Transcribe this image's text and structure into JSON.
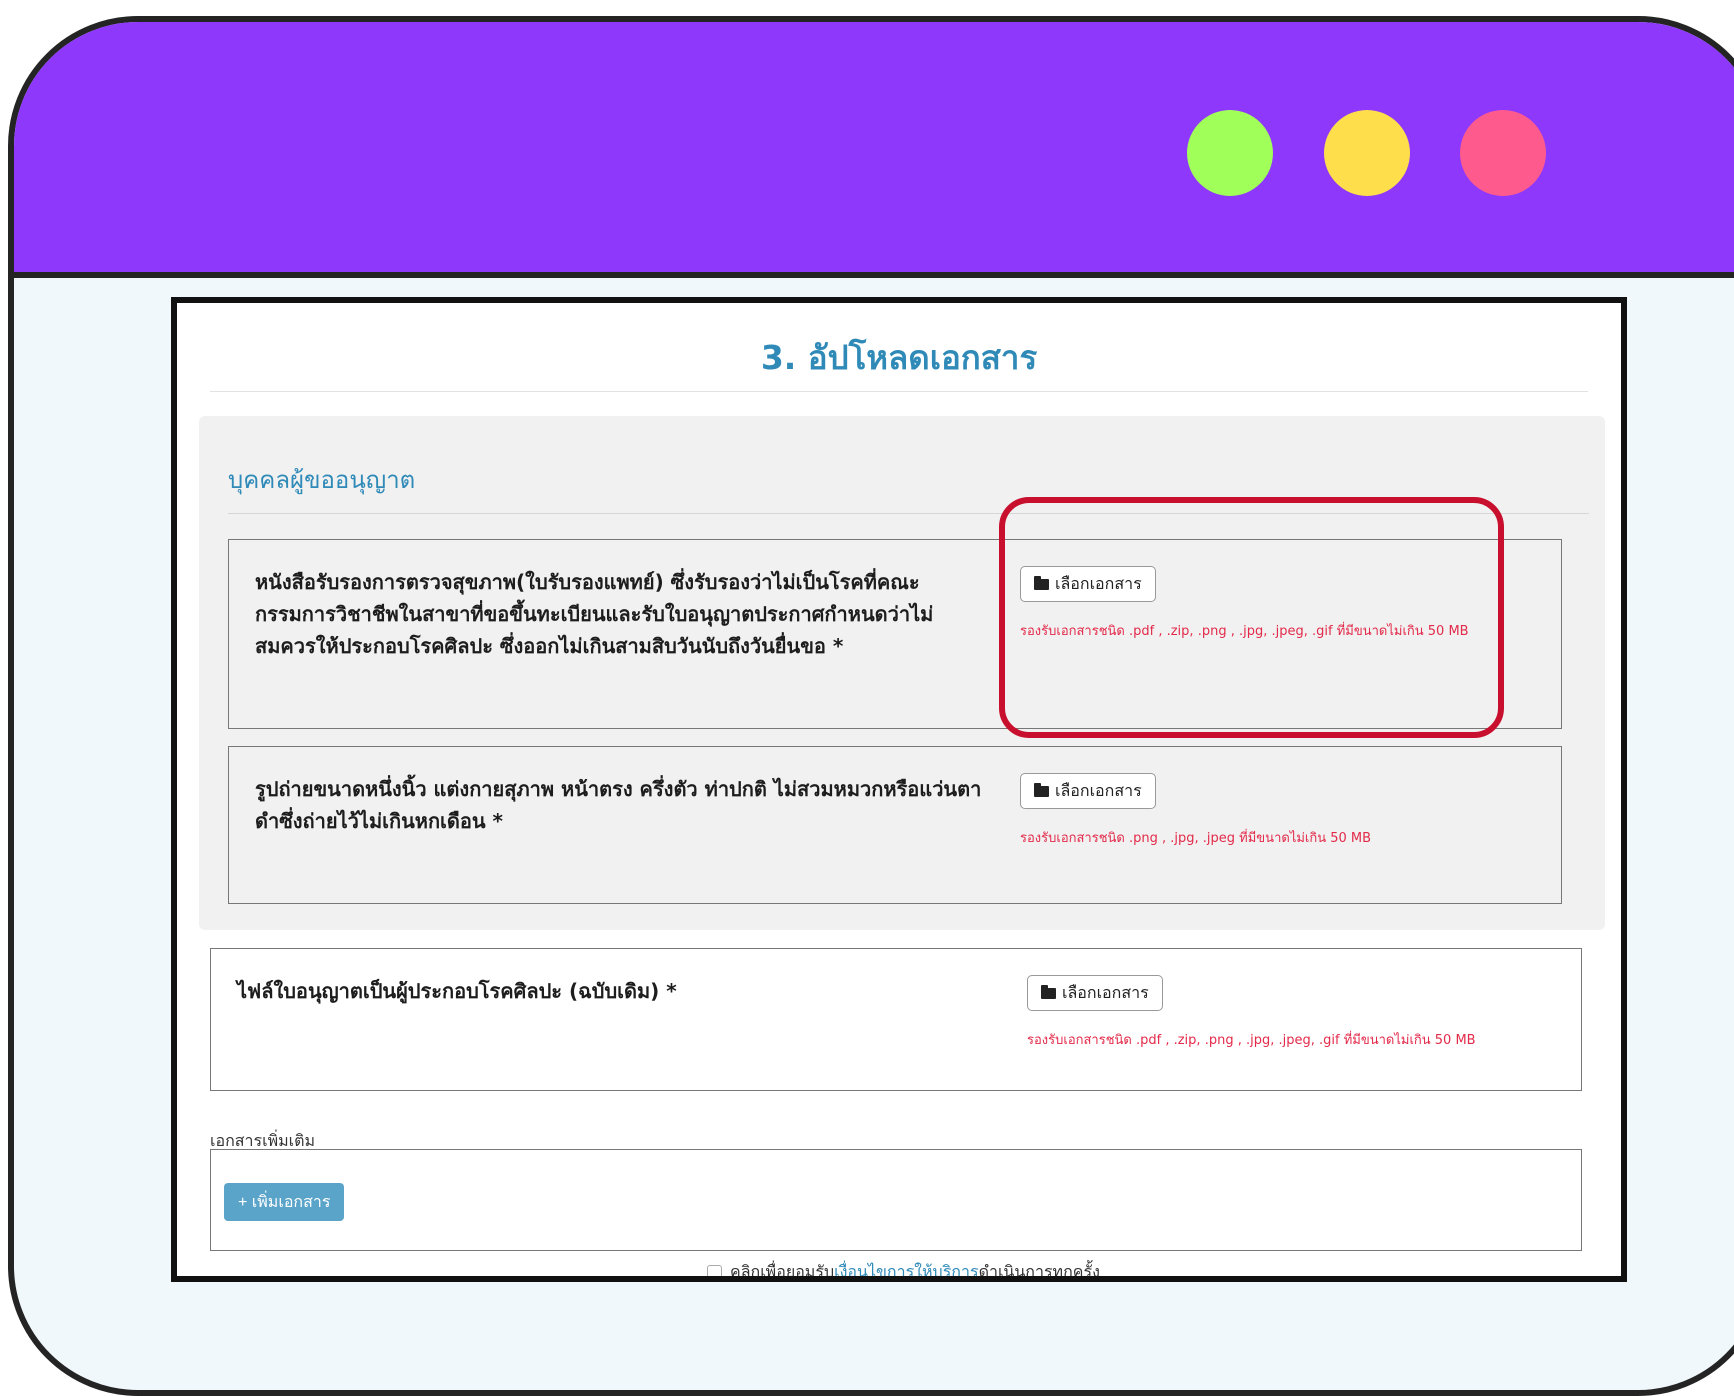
{
  "window": {
    "dots": [
      {
        "name": "green-dot",
        "color": "#a0ff58"
      },
      {
        "name": "yellow-dot",
        "color": "#ffde4b"
      },
      {
        "name": "pink-dot",
        "color": "#ff5a8e"
      }
    ]
  },
  "page": {
    "title": "3. อัปโหลดเอกสาร",
    "section_title": "บุคคลผู้ขออนุญาต"
  },
  "documents": [
    {
      "label": "หนังสือรับรองการตรวจสุขภาพ(ใบรับรองแพทย์) ซึ่งรับรองว่าไม่เป็นโรคที่คณะกรรมการวิชาชีพในสาขาที่ขอขึ้นทะเบียนและรับใบอนุญาตประกาศกำหนดว่าไม่สมควรให้ประกอบโรคศิลปะ ซึ่งออกไม่เกินสามสิบวันนับถึงวันยื่นขอ *",
      "button": "เลือกเอกสาร",
      "hint": "รองรับเอกสารชนิด .pdf , .zip, .png , .jpg, .jpeg, .gif ที่มีขนาดไม่เกิน 50 MB"
    },
    {
      "label": "รูปถ่ายขนาดหนึ่งนิ้ว แต่งกายสุภาพ หน้าตรง ครึ่งตัว ท่าปกติ ไม่สวมหมวกหรือแว่นตาดำซึ่งถ่ายไว้ไม่เกินหกเดือน *",
      "button": "เลือกเอกสาร",
      "hint": "รองรับเอกสารชนิด .png , .jpg, .jpeg ที่มีขนาดไม่เกิน 50 MB"
    },
    {
      "label": "ไฟล์ใบอนุญาตเป็นผู้ประกอบโรคศิลปะ (ฉบับเดิม) *",
      "button": "เลือกเอกสาร",
      "hint": "รองรับเอกสารชนิด .pdf , .zip, .png , .jpg, .jpeg, .gif ที่มีขนาดไม่เกิน 50 MB"
    }
  ],
  "extra": {
    "label": "เอกสารเพิ่มเติม",
    "add_button": "+ เพิ่มเอกสาร"
  },
  "consent": {
    "prefix": "คลิกเพื่อยอมรับ",
    "link": "เงื่อนไขการให้บริการ",
    "suffix": "ดำเนินการทุกครั้ง"
  }
}
